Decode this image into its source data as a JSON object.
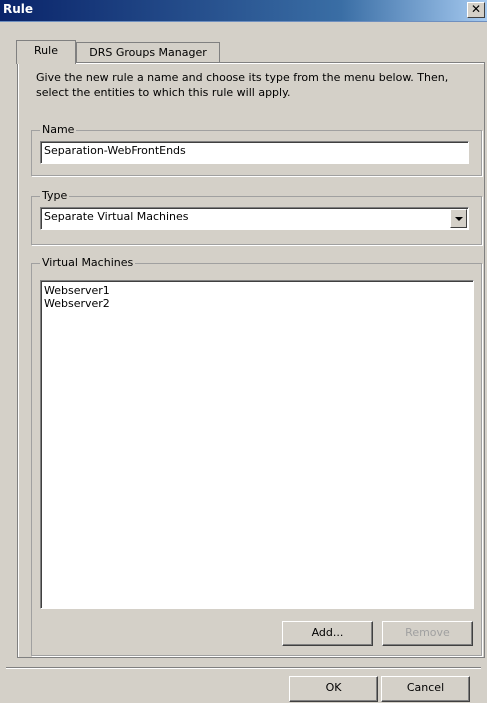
{
  "window": {
    "title": "Rule",
    "close_glyph": "✕"
  },
  "tabs": [
    {
      "label": "Rule",
      "active": true
    },
    {
      "label": "DRS Groups Manager",
      "active": false
    }
  ],
  "description": "Give the new rule a name and choose its type from the menu below. Then, select the entities to which this rule will apply.",
  "name_group": {
    "legend": "Name",
    "value": "Separation-WebFrontEnds"
  },
  "type_group": {
    "legend": "Type",
    "selected": "Separate Virtual Machines"
  },
  "vm_group": {
    "legend": "Virtual Machines",
    "items": [
      "Webserver1",
      "Webserver2"
    ],
    "add_label": "Add...",
    "remove_label": "Remove"
  },
  "footer": {
    "ok_label": "OK",
    "cancel_label": "Cancel"
  }
}
